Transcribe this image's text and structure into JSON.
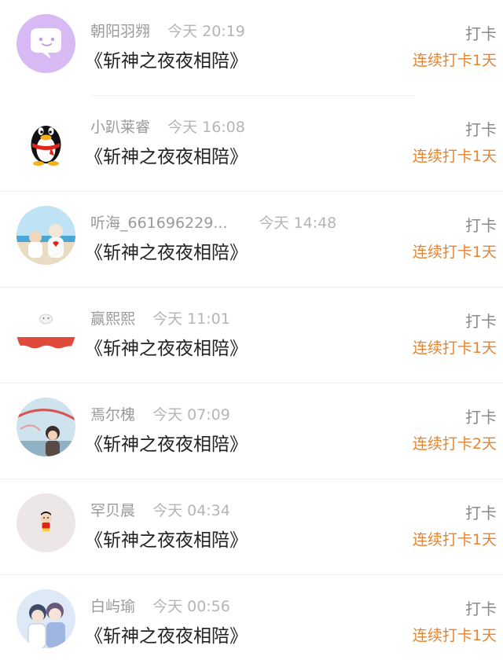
{
  "entries": [
    {
      "name": "朝阳羽翙",
      "time": "今天 20:19",
      "title": "《斩神之夜夜相陪》",
      "action": "打卡",
      "streak": "连续打卡1天",
      "avatar_icon": "chat-bubble-icon"
    },
    {
      "name": "小趴莱睿",
      "time": "今天 16:08",
      "title": "《斩神之夜夜相陪》",
      "action": "打卡",
      "streak": "连续打卡1天",
      "avatar_icon": "penguin-icon"
    },
    {
      "name": "听海_661696229...",
      "time": "今天 14:48",
      "title": "《斩神之夜夜相陪》",
      "action": "打卡",
      "streak": "连续打卡1天",
      "avatar_icon": "photo-avatar"
    },
    {
      "name": "赢熙熙",
      "time": "今天 11:01",
      "title": "《斩神之夜夜相陪》",
      "action": "打卡",
      "streak": "连续打卡1天",
      "avatar_icon": "holiday-cat-avatar"
    },
    {
      "name": "焉尔槐",
      "time": "今天 07:09",
      "title": "《斩神之夜夜相陪》",
      "action": "打卡",
      "streak": "连续打卡2天",
      "avatar_icon": "photo-avatar"
    },
    {
      "name": "罕贝晨",
      "time": "今天 04:34",
      "title": "《斩神之夜夜相陪》",
      "action": "打卡",
      "streak": "连续打卡1天",
      "avatar_icon": "cartoon-boy-avatar"
    },
    {
      "name": "白屿瑜",
      "time": "今天 00:56",
      "title": "《斩神之夜夜相陪》",
      "action": "打卡",
      "streak": "连续打卡1天",
      "avatar_icon": "anime-couple-avatar"
    }
  ],
  "colors": {
    "streak": "#e8832f",
    "name": "#9a9a9a",
    "title": "#222222",
    "action": "#8a8a8a"
  }
}
